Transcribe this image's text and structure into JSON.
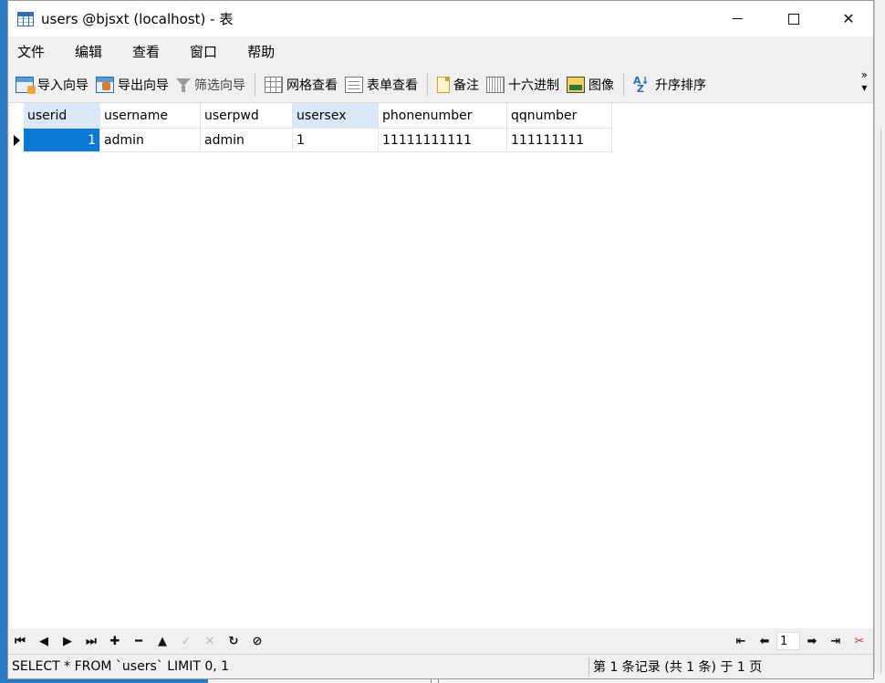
{
  "window": {
    "title": "users @bjsxt (localhost) - 表"
  },
  "menu": [
    "文件",
    "编辑",
    "查看",
    "窗口",
    "帮助"
  ],
  "toolbar": {
    "import_wizard": "导入向导",
    "export_wizard": "导出向导",
    "filter_wizard": "筛选向导",
    "grid_view": "网格查看",
    "form_view": "表单查看",
    "memo": "备注",
    "hex": "十六进制",
    "image": "图像",
    "sort_asc": "升序排序",
    "more_icon": "chevron-double-right-icon"
  },
  "table": {
    "columns": [
      "userid",
      "username",
      "userpwd",
      "usersex",
      "phonenumber",
      "qqnumber"
    ],
    "rows": [
      [
        "1",
        "admin",
        "admin",
        "1",
        "11111111111",
        "111111111"
      ]
    ]
  },
  "navigation": {
    "page": "1"
  },
  "status": {
    "sql": "SELECT * FROM `users` LIMIT 0, 1",
    "record_info": "第 1 条记录 (共 1 条) 于 1 页"
  },
  "colors": {
    "selection": "#0a78d7",
    "header_highlight": "#dbe8f7",
    "desktop": "#2b78c5"
  }
}
